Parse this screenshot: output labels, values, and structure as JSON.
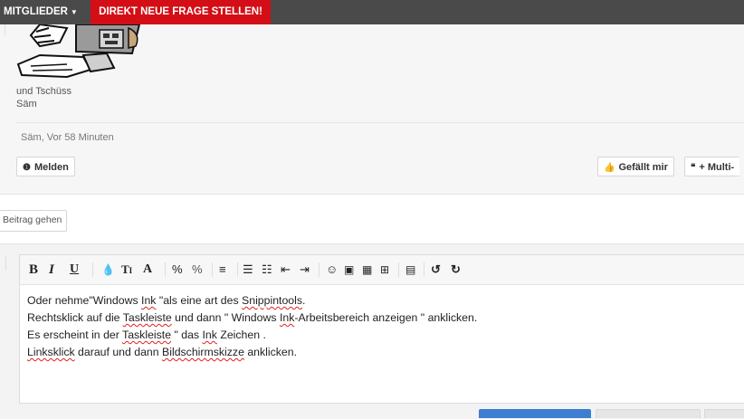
{
  "topnav": {
    "members_label": "MITGLIEDER",
    "ask_label": "DIREKT NEUE FRAGE STELLEN!"
  },
  "post": {
    "signature_lines": [
      "und Tschüss",
      "Säm"
    ],
    "meta": "Säm, Vor 58 Minuten",
    "report_label": "Melden",
    "like_label": "Gefällt mir",
    "multi_quote_label": "+ Multi-"
  },
  "goto_label": "Beitrag gehen",
  "editor": {
    "toolbar_icons": [
      "bold-icon",
      "italic-icon",
      "underline-icon",
      "color-icon",
      "text-size-icon",
      "font-icon",
      "link-icon",
      "unlink-icon",
      "align-icon",
      "unordered-list-icon",
      "ordered-list-icon",
      "outdent-icon",
      "indent-icon",
      "smiley-icon",
      "image-icon",
      "media-icon",
      "insert-icon",
      "save-icon",
      "undo-icon",
      "redo-icon"
    ],
    "lines": [
      "Oder nehme\"Windows Ink \"als eine art des Snippintools.",
      "Rechtsklick auf die Taskleiste und dann \" Windows Ink-Arbeitsbereich anzeigen \" anklicken.",
      "Es erscheint in der Taskleiste \" das Ink Zeichen .",
      "Linksklick darauf und dann Bildschirmskizze anklicken."
    ]
  },
  "colors": {
    "nav_bg": "#4a4a4a",
    "ask_bg": "#d40e16",
    "submit_bg": "#3d7ed0"
  }
}
